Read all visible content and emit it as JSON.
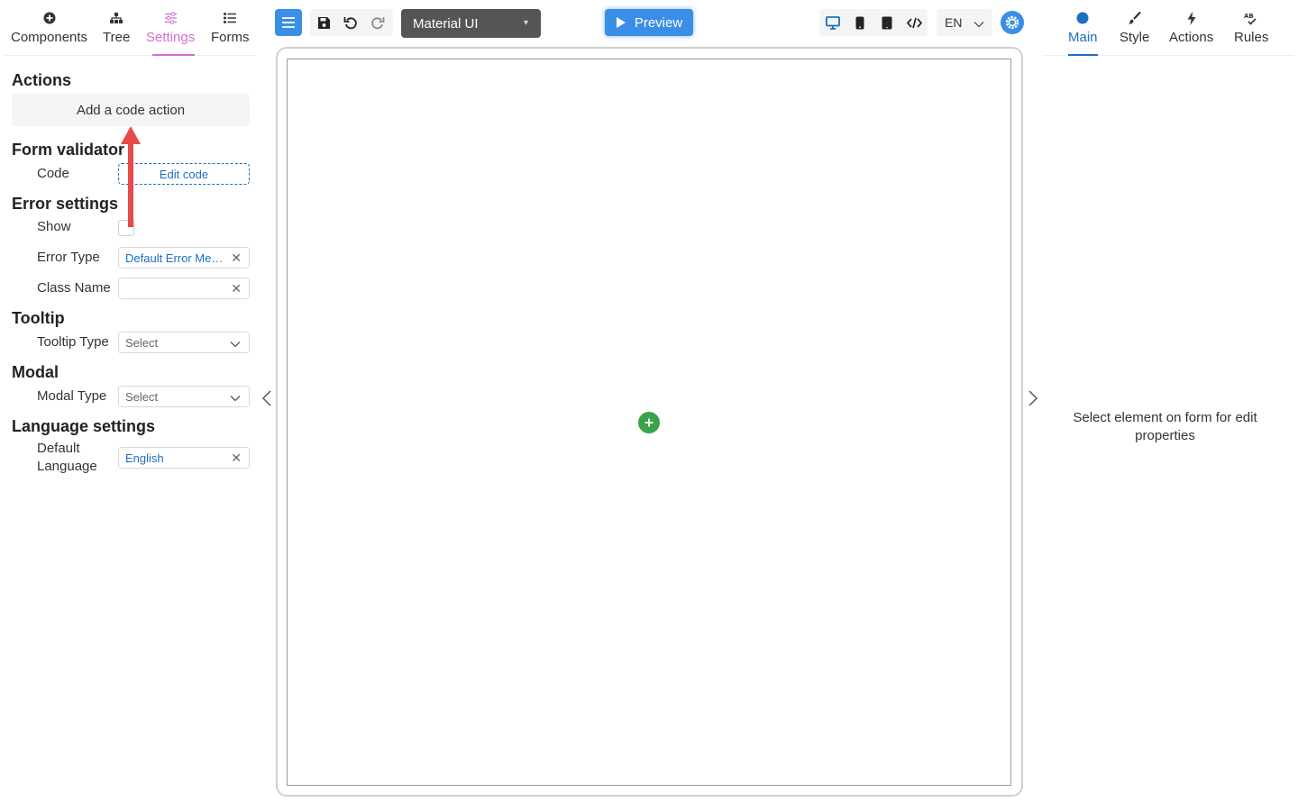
{
  "left_tabs": [
    {
      "label": "Components",
      "icon": "plus-circle-icon"
    },
    {
      "label": "Tree",
      "icon": "tree-icon"
    },
    {
      "label": "Settings",
      "icon": "sliders-icon",
      "active": true
    },
    {
      "label": "Forms",
      "icon": "list-icon"
    }
  ],
  "settings": {
    "actions": {
      "title": "Actions",
      "add_label": "Add a code action"
    },
    "form_validator": {
      "title": "Form validator",
      "code_label": "Code",
      "edit_label": "Edit code"
    },
    "error_settings": {
      "title": "Error settings",
      "show_label": "Show",
      "show_checked": false,
      "error_type_label": "Error Type",
      "error_type_value": "Default Error Message",
      "class_name_label": "Class Name",
      "class_name_value": ""
    },
    "tooltip": {
      "title": "Tooltip",
      "type_label": "Tooltip Type",
      "type_placeholder": "Select"
    },
    "modal": {
      "title": "Modal",
      "type_label": "Modal Type",
      "type_placeholder": "Select"
    },
    "language": {
      "title": "Language settings",
      "default_label_1": "Default",
      "default_label_2": "Language",
      "default_value": "English"
    }
  },
  "toolbar": {
    "theme": "Material UI",
    "preview_label": "Preview",
    "language": "EN",
    "icons": [
      "menu-icon",
      "save-icon",
      "undo-icon",
      "redo-icon",
      "desktop-icon",
      "mobile-icon",
      "tablet-icon",
      "code-icon",
      "gear-icon"
    ]
  },
  "right_tabs": [
    {
      "label": "Main",
      "icon": "circle-icon",
      "active": true
    },
    {
      "label": "Style",
      "icon": "brush-icon"
    },
    {
      "label": "Actions",
      "icon": "lightning-icon"
    },
    {
      "label": "Rules",
      "icon": "spellcheck-icon"
    }
  ],
  "right_panel": {
    "empty_message": "Select element on form for edit properties"
  },
  "colors": {
    "accent": "#3a8ee6",
    "settings_tab": "#d36ed2",
    "link": "#1d6fbf",
    "add_button": "#3ba24b",
    "annotation_arrow": "#e84a4a"
  }
}
